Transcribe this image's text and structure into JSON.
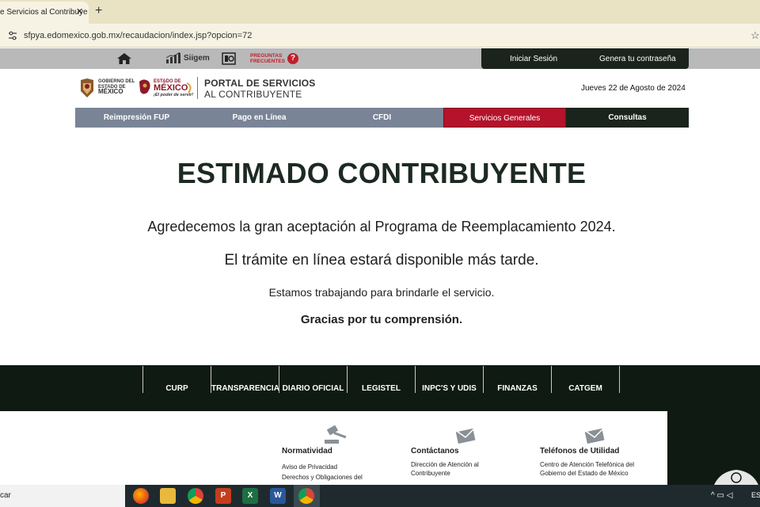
{
  "browser": {
    "tab_title": "e Servicios al Contribuye",
    "tab_close": "✕",
    "new_tab": "+",
    "url": "sfpya.edomexico.gob.mx/recaudacion/index.jsp?opcion=72",
    "star": "☆"
  },
  "topbar": {
    "siigem_label": "Siigem",
    "faq_line1": "PREGUNTAS",
    "faq_line2": "FRECUENTES",
    "faq_badge": "?",
    "login_label": "Iniciar Sesión",
    "generate_password_label": "Genera tu contraseña"
  },
  "header": {
    "gob_line1": "GOBIERNO DEL",
    "gob_line2": "ESTADO DE",
    "gob_line3": "MÉXICO",
    "edo_line1": "ESTADO DE",
    "edo_line2": "MÉXICO",
    "edo_tagline": "¡El poder de servir!",
    "portal_line1": "PORTAL DE SERVICIOS",
    "portal_line2": "AL CONTRIBUYENTE",
    "date": "Jueves 22 de Agosto de 2024"
  },
  "menu": {
    "items": [
      "Reimpresión FUP",
      "Pago en Línea",
      "CFDI",
      "Servicios Generales",
      "Consultas"
    ],
    "active": "Servicios Generales"
  },
  "message": {
    "title": "ESTIMADO CONTRIBUYENTE",
    "line1": "Agredecemos la gran aceptación al Programa de Reemplacamiento 2024.",
    "line2": "El trámite en línea estará disponible más tarde.",
    "line3": "Estamos trabajando para brindarle el servicio.",
    "line4": "Gracias por tu comprensión."
  },
  "footer_links": [
    "CURP",
    "TRANSPARENCIA",
    "DIARIO OFICIAL",
    "LEGISTEL",
    "INPC'S Y UDIS",
    "FINANZAS",
    "CATGEM"
  ],
  "footer_sections": {
    "normatividad": {
      "heading": "Normatividad",
      "link1": "Aviso de Privacidad",
      "link2": "Derechos y Obligaciones del"
    },
    "contactanos": {
      "heading": "Contáctanos",
      "text1": "Dirección de Atención al",
      "text2": "Contribuyente"
    },
    "telefonos": {
      "heading": "Teléfonos de Utilidad",
      "text1": "Centro de Atención Telefónica del",
      "text2": "Gobierno del Estado de México"
    }
  },
  "taskbar": {
    "search_text": "car",
    "language": "ESP",
    "apps": [
      "firefox",
      "file-explorer",
      "chrome",
      "powerpoint",
      "excel",
      "word",
      "chrome-active"
    ],
    "labels": {
      "powerpoint": "P",
      "excel": "X",
      "word": "W"
    }
  },
  "colors": {
    "active_menu": "#b5122b",
    "dark_green": "#1a241c",
    "menu_gray": "#7a8497",
    "brand_red": "#c11d2c"
  }
}
